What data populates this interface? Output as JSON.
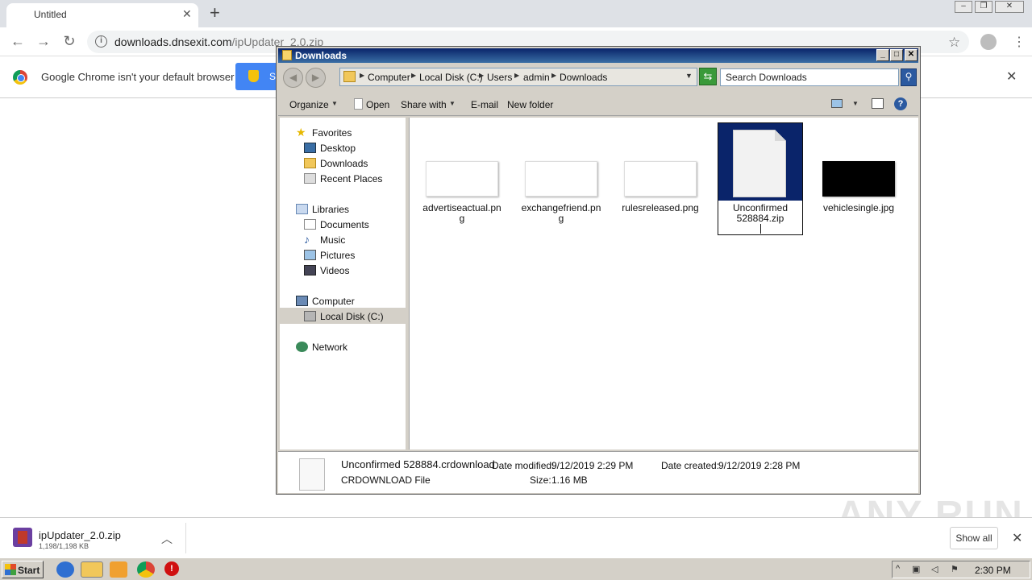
{
  "browser": {
    "tab_title": "Untitled",
    "url_host": "downloads.dnsexit.com",
    "url_path": "/ipUpdater_2.0.zip",
    "infobar_text": "Google Chrome isn't your default browser",
    "infobar_button": "S"
  },
  "explorer": {
    "title": "Downloads",
    "breadcrumbs": [
      "Computer",
      "Local Disk (C:)",
      "Users",
      "admin",
      "Downloads"
    ],
    "search_placeholder": "Search Downloads",
    "commands": {
      "organize": "Organize",
      "open": "Open",
      "share_with": "Share with",
      "email": "E-mail",
      "new_folder": "New folder"
    },
    "nav": {
      "favorites": "Favorites",
      "desktop": "Desktop",
      "downloads": "Downloads",
      "recent_places": "Recent Places",
      "libraries": "Libraries",
      "documents": "Documents",
      "music": "Music",
      "pictures": "Pictures",
      "videos": "Videos",
      "computer": "Computer",
      "local_disk": "Local Disk (C:)",
      "network": "Network"
    },
    "files": [
      {
        "line1": "advertiseactual.pn",
        "line2": "g"
      },
      {
        "line1": "exchangefriend.pn",
        "line2": "g"
      },
      {
        "line1": "rulesreleased.png",
        "line2": ""
      },
      {
        "line1": "Unconfirmed",
        "line2": "528884.zip"
      },
      {
        "line1": "vehiclesingle.jpg",
        "line2": ""
      }
    ],
    "status": {
      "name": "Unconfirmed 528884.crdownload",
      "type": "CRDOWNLOAD File",
      "modified_label": "Date modified:",
      "modified_value": "9/12/2019 2:29 PM",
      "created_label": "Date created:",
      "created_value": "9/12/2019 2:28 PM",
      "size_label": "Size:",
      "size_value": "1.16 MB"
    }
  },
  "download_shelf": {
    "filename": "ipUpdater_2.0.zip",
    "progress": "1,198/1,198 KB",
    "show_all": "Show all"
  },
  "watermark": "ANY RUN",
  "taskbar": {
    "start": "Start",
    "clock": "2:30 PM"
  }
}
